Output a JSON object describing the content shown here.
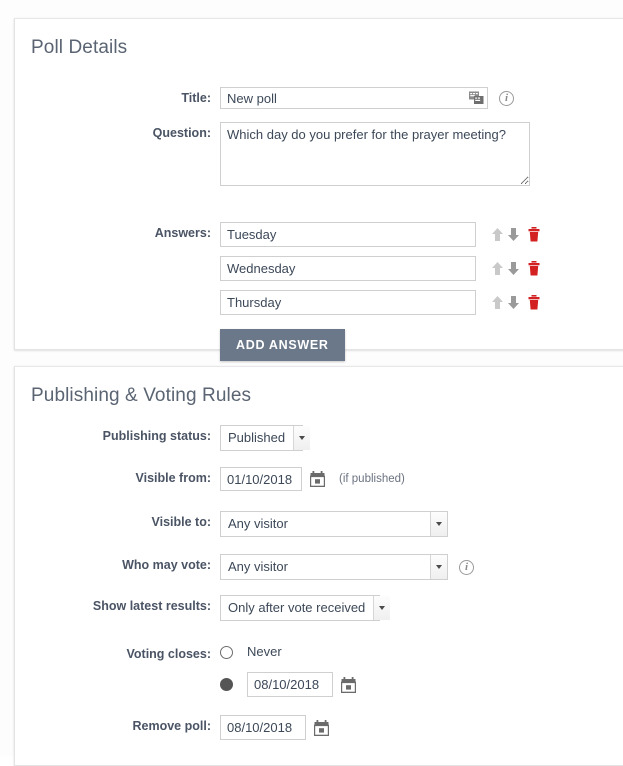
{
  "theme": {
    "accent_button": "#6b7889",
    "trash_red": "#d32020",
    "arrow_down_gray": "#9a9a9a",
    "arrow_up_gray": "#c9c9c9",
    "panel_bg": "#ffffff",
    "page_bg": "#fdfdfd",
    "label_color": "#4a5464",
    "heading_color": "#5a6472"
  },
  "poll_details": {
    "heading": "Poll Details",
    "title_label": "Title:",
    "title_value": "New poll",
    "title_lang_icon": "multilanguage-icon",
    "title_info_icon": "info-icon",
    "question_label": "Question:",
    "question_value": "Which day do you prefer for the prayer meeting?",
    "answers_label": "Answers:",
    "answers": [
      {
        "value": "Tuesday"
      },
      {
        "value": "Wednesday"
      },
      {
        "value": "Thursday"
      }
    ],
    "move_up_icon": "arrow-up-icon",
    "move_down_icon": "arrow-down-icon",
    "delete_icon": "trash-icon",
    "add_answer_label": "ADD ANSWER"
  },
  "publishing": {
    "heading": "Publishing & Voting Rules",
    "publishing_status_label": "Publishing status:",
    "publishing_status_value": "Published",
    "visible_from_label": "Visible from:",
    "visible_from_value": "01/10/2018",
    "visible_from_hint": "(if published)",
    "visible_to_label": "Visible to:",
    "visible_to_value": "Any visitor",
    "who_may_vote_label": "Who may vote:",
    "who_may_vote_value": "Any visitor",
    "who_may_vote_info_icon": "info-icon",
    "show_latest_results_label": "Show latest results:",
    "show_latest_results_value": "Only after vote received",
    "voting_closes_label": "Voting closes:",
    "voting_closes_never_label": "Never",
    "voting_closes_date_value": "08/10/2018",
    "remove_poll_label": "Remove poll:",
    "remove_poll_value": "08/10/2018",
    "calendar_icon": "calendar-icon",
    "dropdown_icon": "chevron-down-icon",
    "radio_never_selected": false,
    "radio_date_selected": true
  }
}
